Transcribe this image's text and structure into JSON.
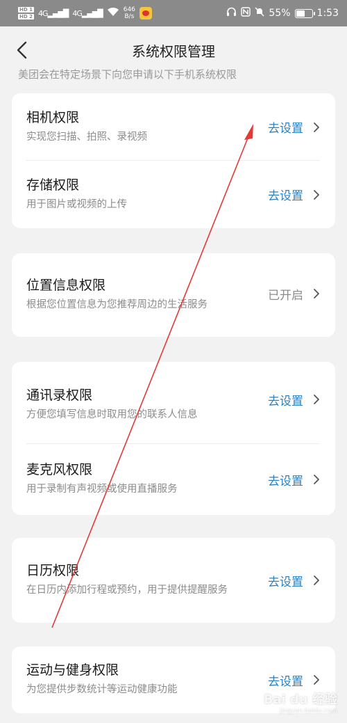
{
  "status_bar": {
    "hd1": "HD 1",
    "hd2": "HD 2",
    "signal1": "4G",
    "signal2": "4G",
    "speed_value": "646",
    "speed_unit": "B/s",
    "battery": "55%",
    "battery_level": 0.55,
    "time": "1:53"
  },
  "header": {
    "title": "系统权限管理"
  },
  "intro": "美团会在特定场景下向您申请以下手机系统权限",
  "groups": [
    {
      "items": [
        {
          "title": "相机权限",
          "desc": "实现您扫描、拍照、录视频",
          "action": "去设置"
        },
        {
          "title": "存储权限",
          "desc": "用于图片或视频的上传",
          "action": "去设置"
        }
      ]
    },
    {
      "items": [
        {
          "title": "位置信息权限",
          "desc": "根据您位置信息为您推荐周边的生活服务",
          "action": "已开启"
        }
      ]
    },
    {
      "items": [
        {
          "title": "通讯录权限",
          "desc": "方便您填写信息时取用您的联系人信息",
          "action": "去设置"
        },
        {
          "title": "麦克风权限",
          "desc": "用于录制有声视频或使用直播服务",
          "action": "去设置"
        }
      ]
    },
    {
      "items": [
        {
          "title": "日历权限",
          "desc": "在日历内添加行程或预约，用于提供提醒服务",
          "action": "去设置"
        }
      ]
    },
    {
      "items": [
        {
          "title": "运动与健身权限",
          "desc": "为您提供步数统计等运动健康功能",
          "action": "去设置"
        }
      ]
    }
  ],
  "colors": {
    "accent": "#2a82c4",
    "annotation": "#e53935"
  },
  "watermark": {
    "brand": "Bai du 经验",
    "url": "jingyan.baidu.com"
  }
}
